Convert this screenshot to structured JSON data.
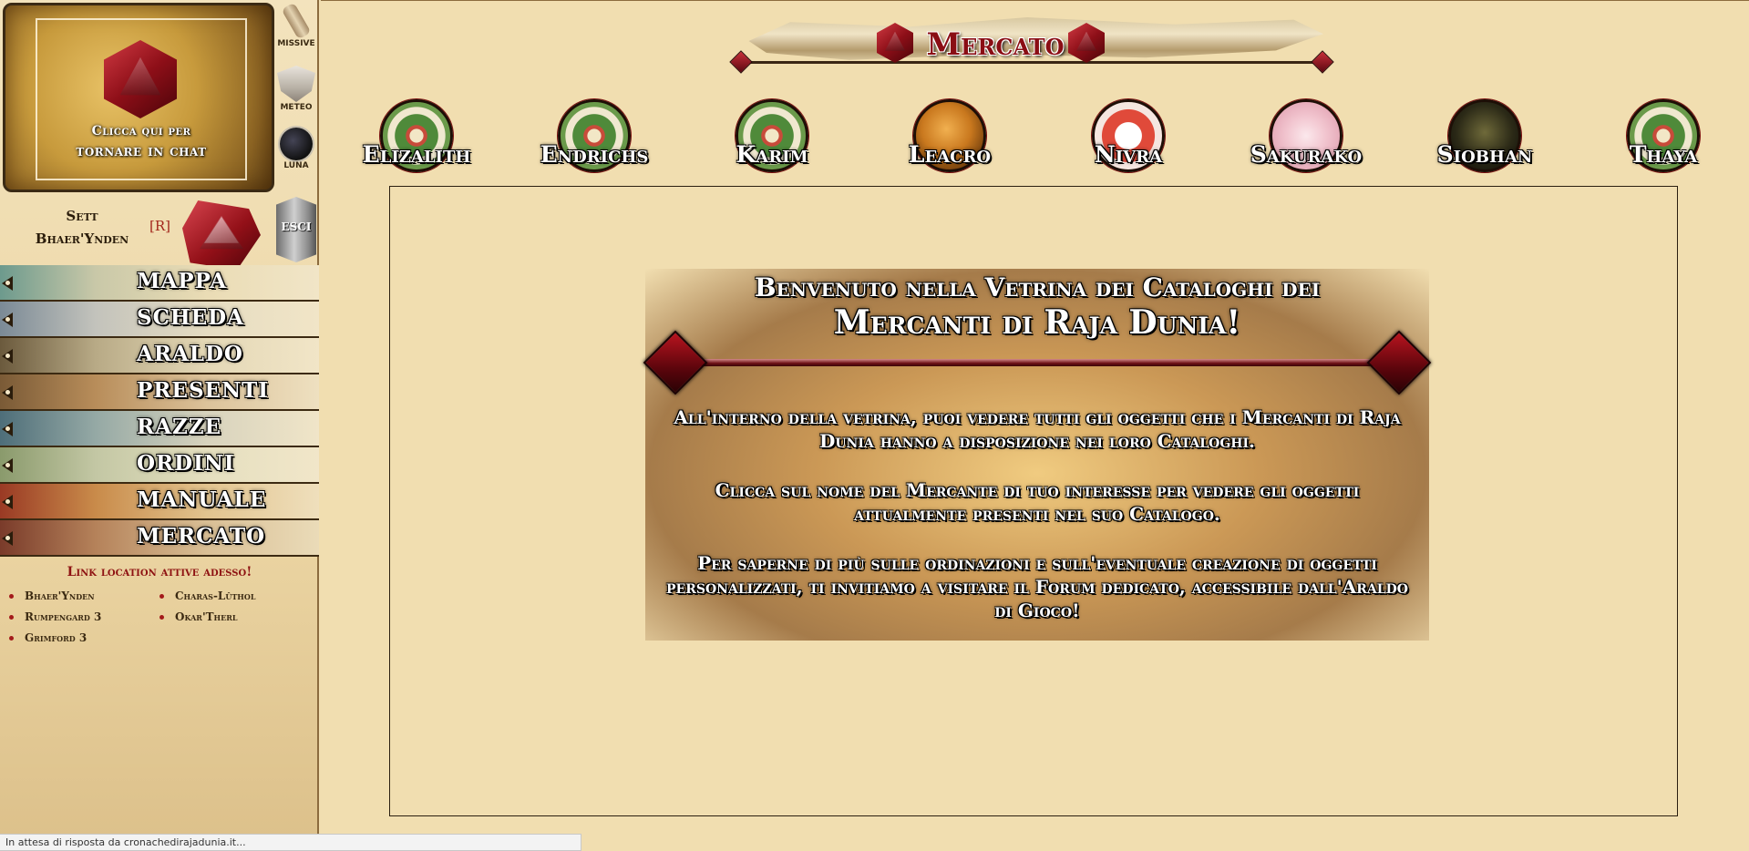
{
  "sidebar": {
    "chat": {
      "line1": "Clicca qui per",
      "line2": "tornare in chat"
    },
    "tools": [
      {
        "label": "MISSIVE",
        "icon": "scroll-icon"
      },
      {
        "label": "METEO",
        "icon": "weather-icon"
      },
      {
        "label": "LUNA",
        "icon": "moon-icon"
      }
    ],
    "user": {
      "name_line1": "Sett",
      "name_line2": "Bhaer'Ynden",
      "r_link": "[R]",
      "logout_label": "ESCI"
    },
    "nav": [
      {
        "label": "MAPPA"
      },
      {
        "label": "SCHEDA"
      },
      {
        "label": "ARALDO"
      },
      {
        "label": "PRESENTI"
      },
      {
        "label": "RAZZE"
      },
      {
        "label": "ORDINI"
      },
      {
        "label": "MANUALE"
      },
      {
        "label": "MERCATO"
      }
    ],
    "active_links": {
      "title": "Link location attive adesso!",
      "items": [
        "Bhaer'Ynden",
        "Charas-Lûthol",
        "Rumpengard 3",
        "Okar'Therl",
        "Grimford 3"
      ]
    }
  },
  "main": {
    "banner_title": "Mercato",
    "merchants": [
      {
        "name": "Elizalith",
        "icon": "flower-emblem-icon"
      },
      {
        "name": "Endrichs",
        "icon": "flower-emblem-icon"
      },
      {
        "name": "Karim",
        "icon": "flower-emblem-icon"
      },
      {
        "name": "Leacro",
        "icon": "griffin-emblem-icon"
      },
      {
        "name": "Nivra",
        "icon": "fox-emblem-icon"
      },
      {
        "name": "Sakurako",
        "icon": "blossom-emblem-icon"
      },
      {
        "name": "Siobhan",
        "icon": "smoke-emblem-icon"
      },
      {
        "name": "Thaya",
        "icon": "flower-emblem-icon"
      }
    ],
    "welcome": {
      "title_line1": "Benvenuto nella Vetrina dei Cataloghi dei",
      "title_line2": "Mercanti di Raja Dunia!",
      "paragraph1": "All'interno della vetrina, puoi vedere tutti gli oggetti che i Mercanti di Raja Dunia hanno a disposizione nei loro Cataloghi.",
      "paragraph2": "Clicca sul nome del Mercante di tuo interesse per vedere gli oggetti attualmente presenti nel suo Catalogo.",
      "paragraph3": "Per saperne di più sulle ordinazioni e sull'eventuale creazione di oggetti personalizzati, ti invitiamo a visitare il Forum dedicato, accessibile dall'Araldo di Gioco!"
    }
  },
  "status_bar": "In attesa di risposta da cronachedirajadunia.it..."
}
